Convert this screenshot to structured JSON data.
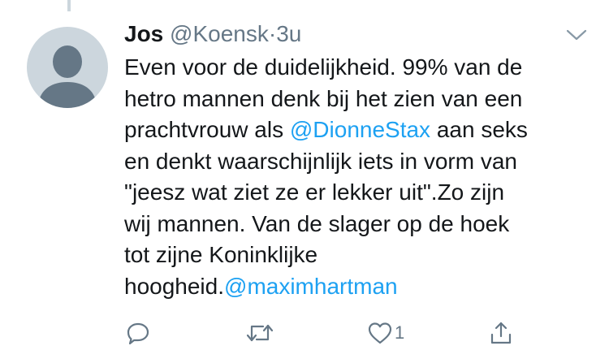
{
  "tweet": {
    "author_name": "Jos",
    "author_handle": "@Koensk",
    "separator": "·",
    "time": "3u",
    "body": {
      "l1": "Even voor de duidelijkheid. 99% van de",
      "l2": "hetro mannen denk bij het zien van een",
      "l3_pre": "prachtvrouw als ",
      "l3_mention": "@DionneStax",
      "l3_post": " aan seks",
      "l4": "en denkt waarschijnlijk iets in vorm van",
      "l5": "\"jeesz wat ziet ze er lekker uit\".Zo zijn",
      "l6": "wij mannen. Van de slager op de hoek",
      "l7": "tot zijne Koninklijke",
      "l8_pre": "hoogheid.",
      "l8_mention": "@maximhartman"
    },
    "actions": {
      "reply_icon": "reply-icon",
      "retweet_icon": "retweet-icon",
      "like_icon": "heart-icon",
      "like_count": "1",
      "share_icon": "share-icon"
    },
    "colors": {
      "text": "#14171a",
      "secondary": "#657786",
      "link": "#1da1f2",
      "avatar_bg": "#ccd6dd",
      "avatar_fg": "#657786"
    }
  }
}
